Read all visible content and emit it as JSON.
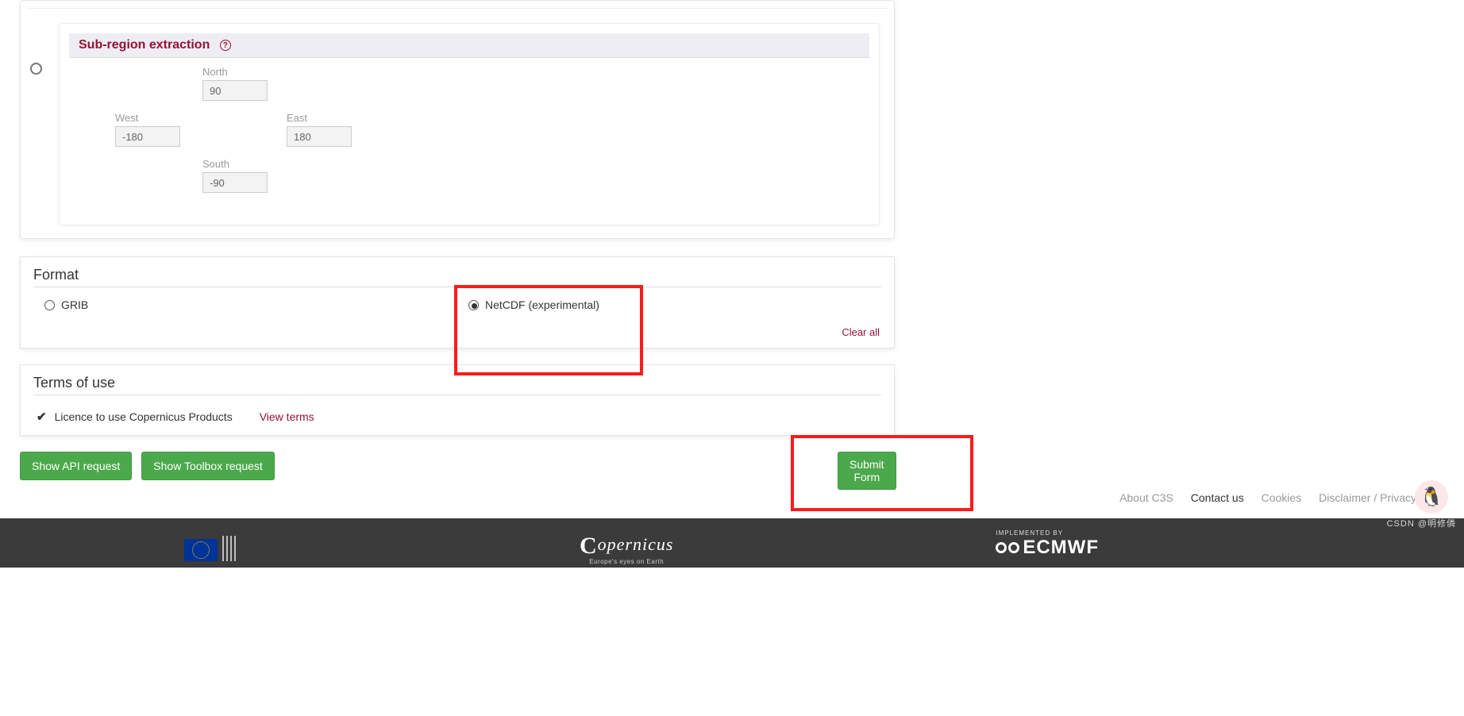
{
  "subregion": {
    "title": "Sub-region extraction",
    "help_glyph": "?",
    "north": {
      "label": "North",
      "value": "90"
    },
    "west": {
      "label": "West",
      "value": "-180"
    },
    "east": {
      "label": "East",
      "value": "180"
    },
    "south": {
      "label": "South",
      "value": "-90"
    }
  },
  "format": {
    "title": "Format",
    "options": {
      "grib": {
        "label": "GRIB",
        "checked": false
      },
      "netcdf": {
        "label": "NetCDF (experimental)",
        "checked": true
      }
    },
    "clear_all": "Clear all"
  },
  "terms": {
    "title": "Terms of use",
    "licence_label": "Licence to use Copernicus Products",
    "view_terms": "View terms"
  },
  "buttons": {
    "api": "Show API request",
    "toolbox": "Show Toolbox request",
    "submit": "Submit Form"
  },
  "footer_links": {
    "about": "About C3S",
    "contact": "Contact us",
    "cookies": "Cookies",
    "disclaimer": "Disclaimer / Privacy"
  },
  "footer_bar": {
    "copernicus": "opernicus",
    "copernicus_sub": "Europe's eyes on Earth",
    "implemented_by": "IMPLEMENTED BY",
    "ecmwf": "ECMWF"
  },
  "watermark": "CSDN @明修僯",
  "mascot_glyph": "🐧"
}
